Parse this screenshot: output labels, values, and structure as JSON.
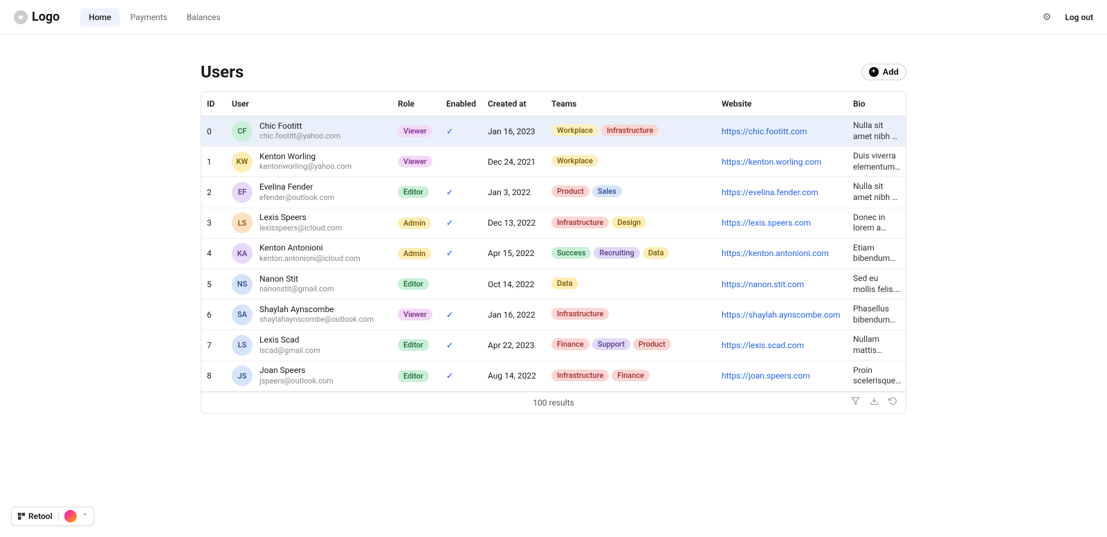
{
  "brand": "Logo",
  "nav": {
    "home": "Home",
    "payments": "Payments",
    "balances": "Balances",
    "logout": "Log out"
  },
  "page": {
    "title": "Users",
    "add": "Add",
    "results": "100 results"
  },
  "columns": {
    "id": "ID",
    "user": "User",
    "role": "Role",
    "enabled": "Enabled",
    "created": "Created at",
    "teams": "Teams",
    "website": "Website",
    "bio": "Bio"
  },
  "retool": "Retool",
  "roleClasses": {
    "Viewer": "bg-viewer",
    "Editor": "bg-editor",
    "Admin": "bg-admin"
  },
  "teamClasses": {
    "Workplace": "bg-workplace",
    "Infrastructure": "bg-infrastructure",
    "Product": "bg-product",
    "Sales": "bg-sales",
    "Design": "bg-design",
    "Success": "bg-success",
    "Recruiting": "bg-recruiting",
    "Data": "bg-data",
    "Finance": "bg-finance",
    "Support": "bg-support"
  },
  "rows": [
    {
      "id": 0,
      "selected": true,
      "initials": "CF",
      "avClass": "av-green",
      "name": "Chic Footitt",
      "email": "chic.footitt@yahoo.com",
      "role": "Viewer",
      "enabled": true,
      "created": "Jan 16, 2023",
      "teams": [
        "Workplace",
        "Infrastructure"
      ],
      "website": "https://chic.footitt.com",
      "bio": "Nulla sit amet nibh at augue placerat"
    },
    {
      "id": 1,
      "initials": "KW",
      "avClass": "av-yellow",
      "name": "Kenton Worling",
      "email": "kentonworling@yahoo.com",
      "role": "Viewer",
      "enabled": false,
      "created": "Dec 24, 2021",
      "teams": [
        "Workplace"
      ],
      "website": "https://kenton.worling.com",
      "bio": "Duis viverra elementum nunc"
    },
    {
      "id": 2,
      "initials": "EF",
      "avClass": "av-purple",
      "name": "Evelina Fender",
      "email": "efender@outlook.com",
      "role": "Editor",
      "enabled": true,
      "created": "Jan 3, 2022",
      "teams": [
        "Product",
        "Sales"
      ],
      "website": "https://evelina.fender.com",
      "bio": "Nulla sit amet nibh at augue placerat"
    },
    {
      "id": 3,
      "initials": "LS",
      "avClass": "av-orange",
      "name": "Lexis Speers",
      "email": "lexisspeers@icloud.com",
      "role": "Admin",
      "enabled": true,
      "created": "Dec 13, 2022",
      "teams": [
        "Infrastructure",
        "Design"
      ],
      "website": "https://lexis.speers.com",
      "bio": "Donec in lorem a dolor tempor"
    },
    {
      "id": 4,
      "initials": "KA",
      "avClass": "av-purple",
      "name": "Kenton Antonioni",
      "email": "kenton.antonioni@icloud.com",
      "role": "Admin",
      "enabled": true,
      "created": "Apr 15, 2022",
      "teams": [
        "Success",
        "Recruiting",
        "Data"
      ],
      "website": "https://kenton.antonioni.com",
      "bio": "Etiam bibendum mauris"
    },
    {
      "id": 5,
      "initials": "NS",
      "avClass": "av-blue",
      "name": "Nanon Stit",
      "email": "nanonstit@gmail.com",
      "role": "Editor",
      "enabled": false,
      "created": "Oct 14, 2022",
      "teams": [
        "Data"
      ],
      "website": "https://nanon.stit.com",
      "bio": "Sed eu mollis felis. Nulla sit amet"
    },
    {
      "id": 6,
      "initials": "SA",
      "avClass": "av-blue",
      "name": "Shaylah Aynscombe",
      "email": "shaylahaynscombe@outlook.com",
      "role": "Viewer",
      "enabled": true,
      "created": "Jan 16, 2022",
      "teams": [
        "Infrastructure"
      ],
      "website": "https://shaylah.aynscombe.com",
      "bio": "Phasellus bibendum mauris"
    },
    {
      "id": 7,
      "initials": "LS",
      "avClass": "av-blue",
      "name": "Lexis Scad",
      "email": "lscad@gmail.com",
      "role": "Editor",
      "enabled": true,
      "created": "Apr 22, 2023",
      "teams": [
        "Finance",
        "Support",
        "Product"
      ],
      "website": "https://lexis.scad.com",
      "bio": "Nullam mattis ultricies metus"
    },
    {
      "id": 8,
      "initials": "JS",
      "avClass": "av-blue",
      "name": "Joan Speers",
      "email": "jspeers@outlook.com",
      "role": "Editor",
      "enabled": true,
      "created": "Aug 14, 2022",
      "teams": [
        "Infrastructure",
        "Finance"
      ],
      "website": "https://joan.speers.com",
      "bio": "Proin scelerisque tortor"
    }
  ]
}
